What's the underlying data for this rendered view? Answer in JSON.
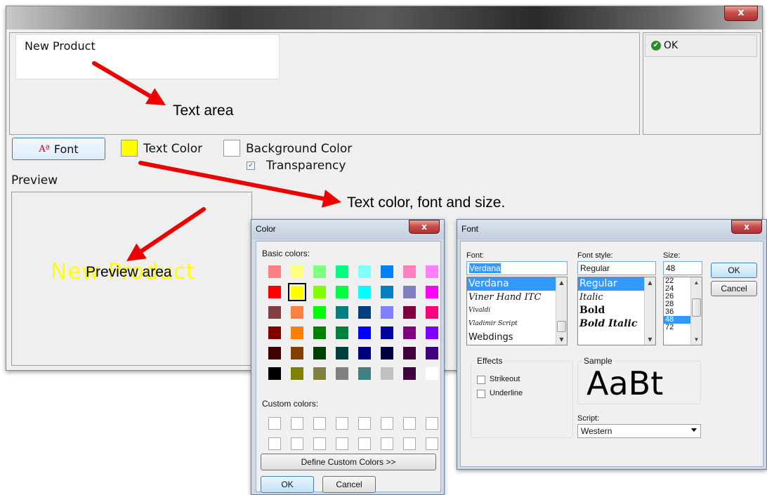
{
  "main_window": {
    "close_glyph": "x",
    "text_area_value": "New Product",
    "ok_label": "OK",
    "ok_icon_glyph": "✔",
    "font_button_icon": "Aª",
    "font_button_label": "Font",
    "text_color_label": "Text Color",
    "text_color_hex": "#ffff00",
    "background_color_label": "Background Color",
    "background_color_hex": "#ffffff",
    "transparency_label": "Transparency",
    "transparency_checked": true,
    "transparency_glyph": "✓",
    "preview_heading": "Preview",
    "preview_text": "New Product"
  },
  "annotations": {
    "text_area": "Text area",
    "color_font_size": "Text color, font and size.",
    "preview_area": "Preview area"
  },
  "color_dialog": {
    "title": "Color",
    "close_glyph": "x",
    "basic_colors_label": "Basic colors:",
    "basic_colors": [
      "#ff8080",
      "#ffff80",
      "#80ff80",
      "#00ff80",
      "#80ffff",
      "#0080ff",
      "#ff80c0",
      "#ff80ff",
      "#ff0000",
      "#ffff00",
      "#80ff00",
      "#00ff40",
      "#00ffff",
      "#0080c0",
      "#8080c0",
      "#ff00ff",
      "#804040",
      "#ff8040",
      "#00ff00",
      "#008080",
      "#004080",
      "#8080ff",
      "#800040",
      "#ff0080",
      "#800000",
      "#ff8000",
      "#008000",
      "#008040",
      "#0000ff",
      "#0000a0",
      "#800080",
      "#8000ff",
      "#400000",
      "#804000",
      "#004000",
      "#004040",
      "#000080",
      "#000040",
      "#400040",
      "#400080",
      "#000000",
      "#808000",
      "#808040",
      "#808080",
      "#408080",
      "#c0c0c0",
      "#400040",
      "#ffffff"
    ],
    "selected_color_index": 9,
    "custom_colors_label": "Custom colors:",
    "custom_colors": [
      "#ffffff",
      "#ffffff",
      "#ffffff",
      "#ffffff",
      "#ffffff",
      "#ffffff",
      "#ffffff",
      "#ffffff",
      "#ffffff",
      "#ffffff",
      "#ffffff",
      "#ffffff",
      "#ffffff",
      "#ffffff",
      "#ffffff",
      "#ffffff"
    ],
    "define_custom_label": "Define Custom Colors >>",
    "ok_label": "OK",
    "cancel_label": "Cancel"
  },
  "font_dialog": {
    "title": "Font",
    "close_glyph": "x",
    "font_label": "Font:",
    "font_value": "Verdana",
    "fonts": [
      "Verdana",
      "Viner Hand ITC",
      "Vivaldi",
      "Vladimir Script",
      "Webdings"
    ],
    "style_label": "Font style:",
    "style_value": "Regular",
    "styles": [
      "Regular",
      "Italic",
      "Bold",
      "Bold Italic"
    ],
    "size_label": "Size:",
    "size_value": "48",
    "sizes": [
      "22",
      "24",
      "26",
      "28",
      "36",
      "48",
      "72"
    ],
    "ok_label": "OK",
    "cancel_label": "Cancel",
    "effects_label": "Effects",
    "strikeout_label": "Strikeout",
    "underline_label": "Underline",
    "sample_label": "Sample",
    "sample_text": "AaBt",
    "script_label": "Script:",
    "script_value": "Western"
  },
  "colors": {
    "arrow": "#ee0000",
    "selection": "#3399ff"
  }
}
